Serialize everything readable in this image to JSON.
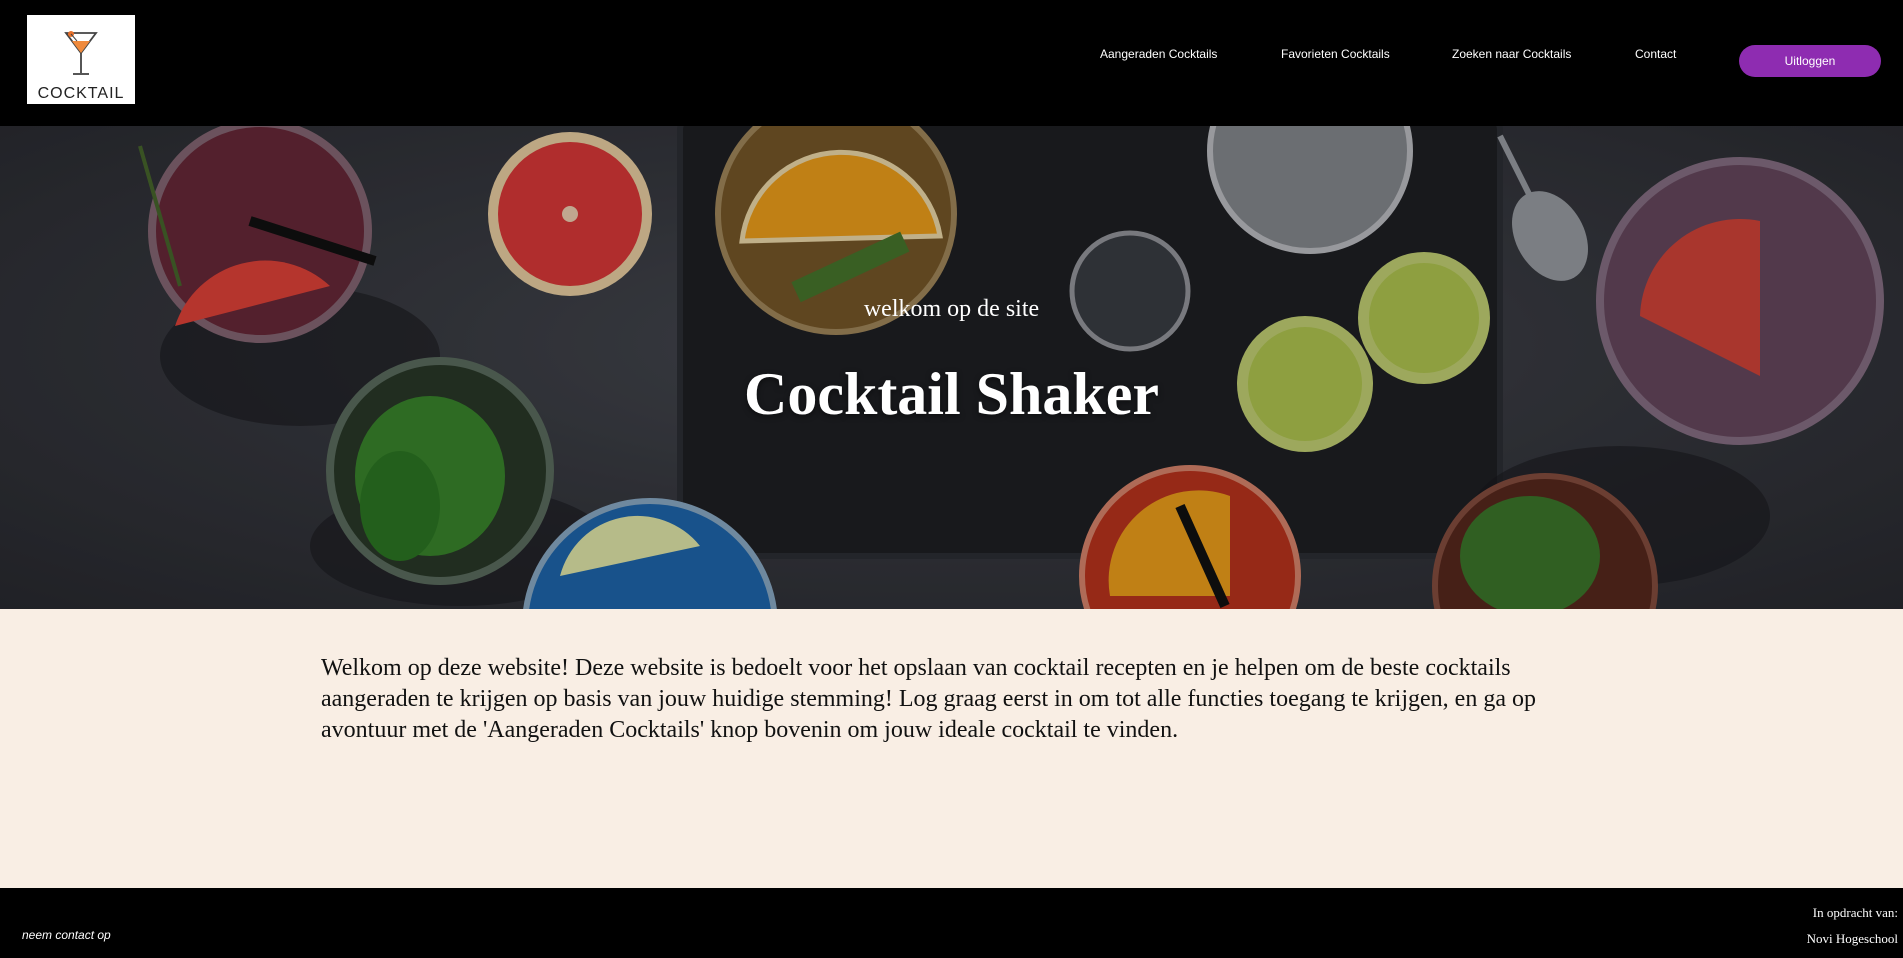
{
  "header": {
    "logo_text": "COCKTAIL",
    "nav": [
      {
        "label": "Aangeraden Cocktails"
      },
      {
        "label": "Favorieten Cocktails"
      },
      {
        "label": "Zoeken naar Cocktails"
      },
      {
        "label": "Contact"
      }
    ],
    "logout_label": "Uitloggen"
  },
  "hero": {
    "subtitle": "welkom op de site",
    "title": "Cocktail Shaker"
  },
  "main": {
    "intro": "Welkom op deze website! Deze website is bedoelt voor het opslaan van cocktail recepten en je helpen om de beste cocktails aangeraden te krijgen op basis van jouw huidige stemming! Log graag eerst in om tot alle functies toegang te krijgen, en ga op avontuur met de 'Aangeraden Cocktails' knop bovenin om jouw ideale cocktail te vinden."
  },
  "footer": {
    "contact": "neem contact op",
    "commission_label": "In opdracht van:",
    "commission_name": "Novi Hogeschool"
  },
  "colors": {
    "header_bg": "#000000",
    "accent": "#8e2cb1",
    "content_bg": "#f9eee4"
  },
  "icons": {
    "logo": "martini-glass-icon"
  }
}
